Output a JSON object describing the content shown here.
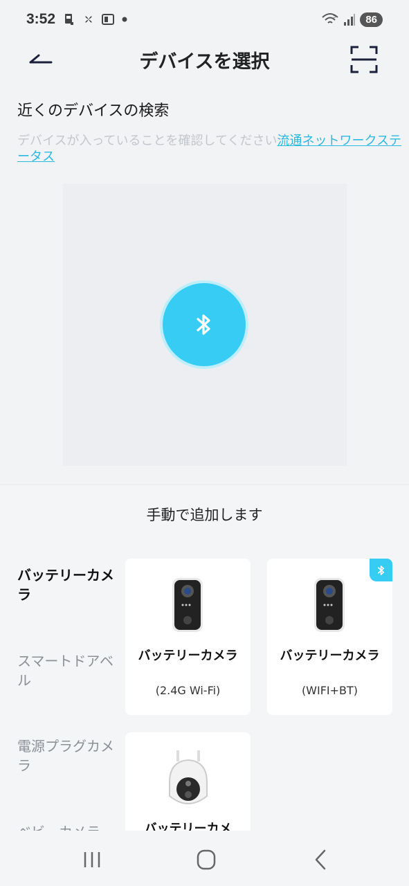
{
  "status_bar": {
    "time": "3:52",
    "left_icons": [
      "nfc-icon",
      "fan-icon",
      "news-icon",
      "dot-icon"
    ],
    "right_icons": [
      "wifi-icon",
      "signal-icon"
    ],
    "battery": "86"
  },
  "header": {
    "title": "デバイスを選択",
    "back_icon": "back-arrow-icon",
    "scan_icon": "scan-icon"
  },
  "search": {
    "title": "近くのデバイスの検索",
    "hint": "デバイスが入っていることを確認してください",
    "hint_link": "流通ネットワークステータス",
    "button_icon": "bluetooth-icon",
    "accent_color": "#36ccf3"
  },
  "manual": {
    "title": "手動で追加します",
    "categories": [
      {
        "label": "バッテリーカメラ",
        "active": true
      },
      {
        "label": "スマートドアベル",
        "active": false
      },
      {
        "label": "電源プラグカメラ",
        "active": false
      },
      {
        "label": "ベビーカメラ",
        "active": false
      }
    ],
    "products": [
      {
        "name": "バッテリーカメラ",
        "sub": "(2.4G Wi-Fi)",
        "bluetooth": false
      },
      {
        "name": "バッテリーカメラ",
        "sub": "(WIFI+BT)",
        "bluetooth": true
      },
      {
        "name": "バッテリーカメ",
        "sub": "",
        "bluetooth": false
      }
    ]
  },
  "nav_bar": {
    "icons": [
      "recent-apps-icon",
      "home-icon",
      "back-icon"
    ]
  }
}
